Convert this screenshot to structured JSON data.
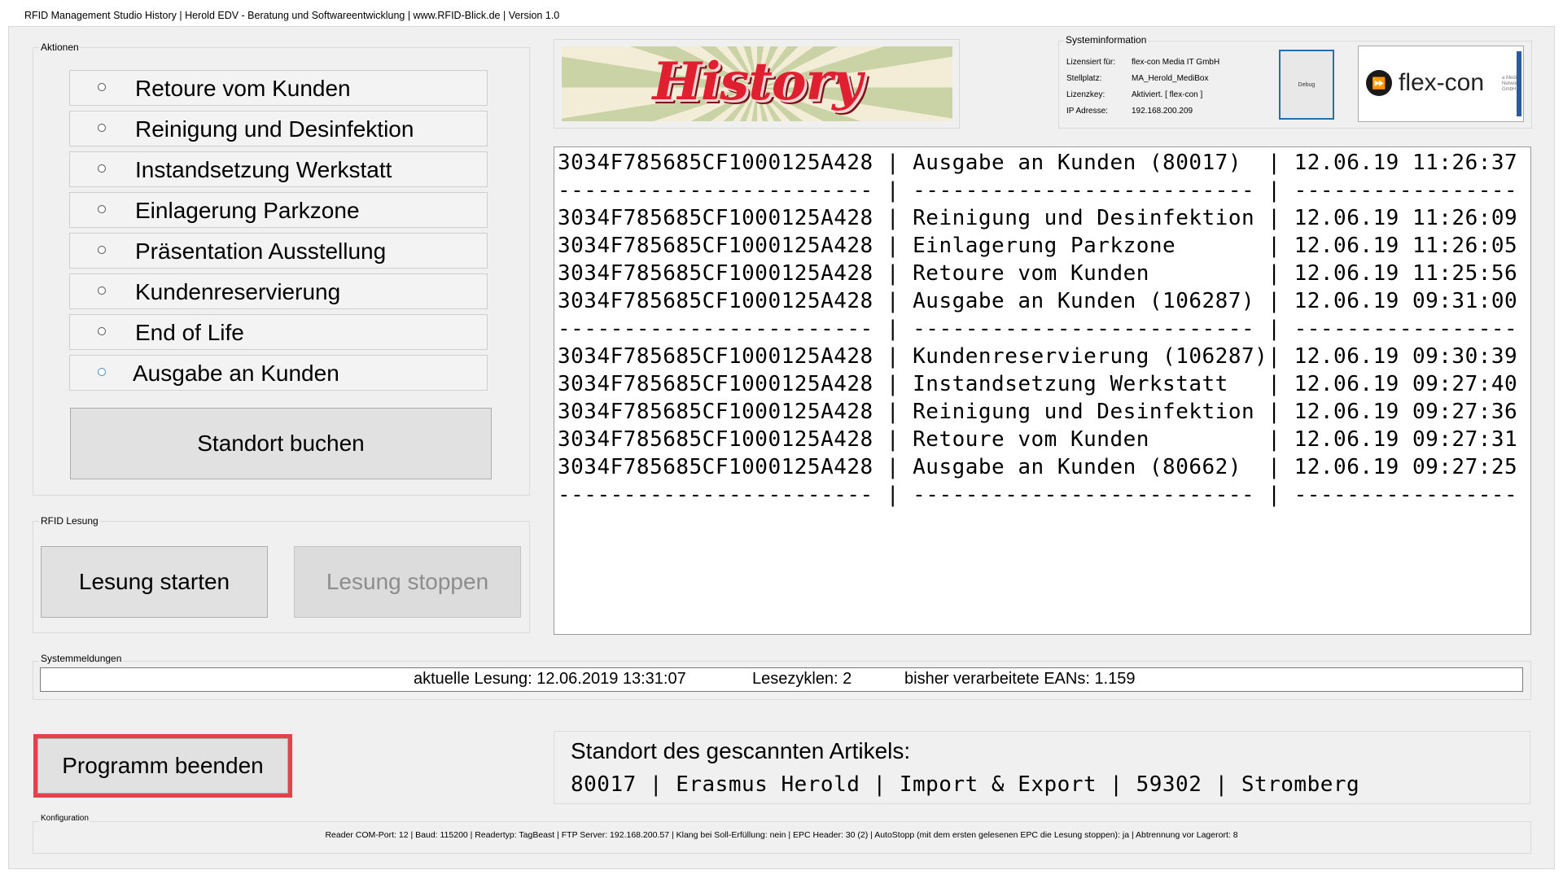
{
  "title_bar": {
    "text": "RFID Management Studio History   |   Herold EDV - Beratung und Softwareentwicklung   |   www.RFID-Blick.de   |   Version 1.0"
  },
  "actions": {
    "group_title": "Aktionen",
    "options": [
      "Retoure vom Kunden",
      "Reinigung und Desinfektion",
      "Instandsetzung Werkstatt",
      "Einlagerung Parkzone",
      "Präsentation Ausstellung",
      "Kundenreservierung",
      "End of Life",
      "Ausgabe an Kunden"
    ],
    "book_button": "Standort buchen"
  },
  "rfid": {
    "group_title": "RFID Lesung",
    "start_button": "Lesung starten",
    "stop_button": "Lesung stoppen"
  },
  "banner": {
    "text": "History"
  },
  "system_info": {
    "group_title": "Systeminformation",
    "rows": [
      {
        "key": "Lizensiert für:",
        "value": "flex-con Media IT GmbH"
      },
      {
        "key": "Stellplatz:",
        "value": "MA_Herold_MediBox"
      },
      {
        "key": "Lizenzkey:",
        "value": "Aktiviert.   [ flex-con ]"
      },
      {
        "key": "IP Adresse:",
        "value": "192.168.200.209"
      }
    ],
    "debug_label": "Debug",
    "logo_text": "flex-con",
    "logo_subtext": "a Media Network GmbH"
  },
  "history": {
    "rows": [
      "3034F785685CF1000125A428 | Ausgabe an Kunden (80017)  | 12.06.19 11:26:37",
      "------------------------ | -------------------------- | -----------------",
      "3034F785685CF1000125A428 | Reinigung und Desinfektion | 12.06.19 11:26:09",
      "3034F785685CF1000125A428 | Einlagerung Parkzone       | 12.06.19 11:26:05",
      "3034F785685CF1000125A428 | Retoure vom Kunden         | 12.06.19 11:25:56",
      "3034F785685CF1000125A428 | Ausgabe an Kunden (106287) | 12.06.19 09:31:00",
      "------------------------ | -------------------------- | -----------------",
      "3034F785685CF1000125A428 | Kundenreservierung (106287)| 12.06.19 09:30:39",
      "3034F785685CF1000125A428 | Instandsetzung Werkstatt   | 12.06.19 09:27:40",
      "3034F785685CF1000125A428 | Reinigung und Desinfektion | 12.06.19 09:27:36",
      "3034F785685CF1000125A428 | Retoure vom Kunden         | 12.06.19 09:27:31",
      "3034F785685CF1000125A428 | Ausgabe an Kunden (80662)  | 12.06.19 09:27:25",
      "------------------------ | -------------------------- | -----------------"
    ]
  },
  "system_messages": {
    "group_title": "Systemmeldungen",
    "current_reading": "aktuelle Lesung: 12.06.2019 13:31:07",
    "read_cycles": "Lesezyklen: 2",
    "processed_eans": "bisher verarbeitete EANs: 1.159"
  },
  "exit_button": "Programm beenden",
  "location": {
    "title": "Standort des gescannten Artikels:",
    "value": "80017 | Erasmus Herold | Import & Export | 59302 | Stromberg"
  },
  "configuration": {
    "group_title": "Konfiguration",
    "text": "Reader COM-Port: 12   |   Baud: 115200   |   Readertyp: TagBeast   |   FTP Server: 192.168.200.57   |   Klang bei Soll-Erfüllung: nein   |   EPC Header: 30 (2)   |   AutoStopp (mit dem ersten gelesenen EPC die Lesung stoppen): ja   |   Abtrennung vor Lagerort: 8"
  }
}
